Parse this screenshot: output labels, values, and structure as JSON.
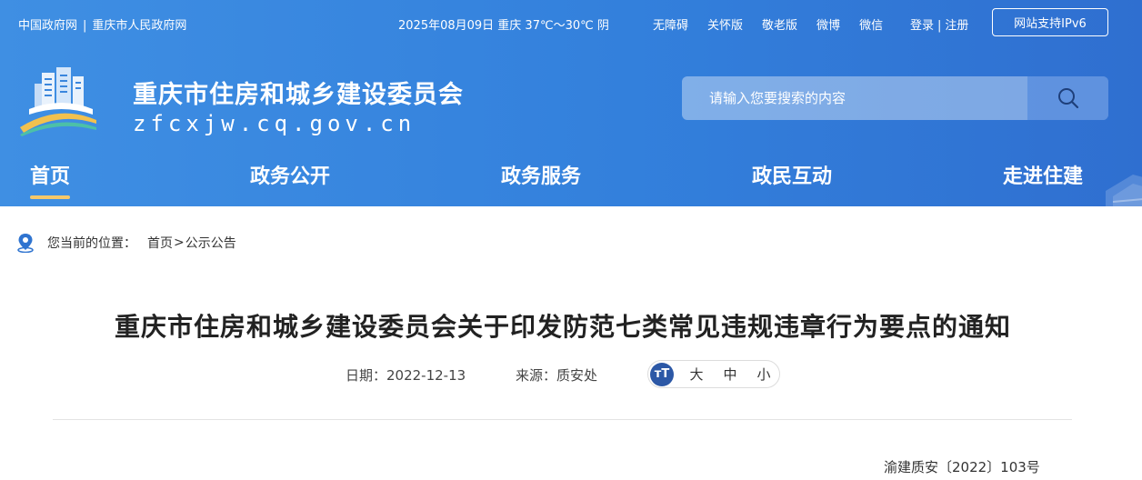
{
  "topbar": {
    "gov_link": "中国政府网",
    "separator": "|",
    "city_link": "重庆市人民政府网",
    "date_weather": "2025年08月09日  重庆  37℃～30℃ 阴",
    "links": [
      "无障碍",
      "关怀版",
      "敬老版",
      "微博",
      "微信"
    ],
    "login": "登录",
    "login_sep": "|",
    "register": "注册",
    "ipv6": "网站支持IPv6"
  },
  "site": {
    "name": "重庆市住房和城乡建设委员会",
    "domain": "zfcxjw.cq.gov.cn"
  },
  "search": {
    "placeholder": "请输入您要搜索的内容"
  },
  "nav": [
    "首页",
    "政务公开",
    "政务服务",
    "政民互动",
    "走进住建"
  ],
  "breadcrumb": {
    "label": "您当前的位置：",
    "home": "首页",
    "gt": ">",
    "current": "公示公告"
  },
  "article": {
    "title": "重庆市住房和城乡建设委员会关于印发防范七类常见违规违章行为要点的通知",
    "date": "日期：2022-12-13",
    "source": "来源：质安处",
    "font_icon": "тT",
    "font_sizes": [
      "大",
      "中",
      "小"
    ],
    "doc_number": "渝建质安〔2022〕103号"
  },
  "icons": {
    "logo": "building-logo-icon",
    "search": "search-icon",
    "location": "location-pin-icon",
    "font_size": "font-size-icon"
  },
  "colors": {
    "header_blue": "#3380dc",
    "nav_active_underline": "#f5c86a",
    "font_icon_bg": "#2c58a6"
  }
}
